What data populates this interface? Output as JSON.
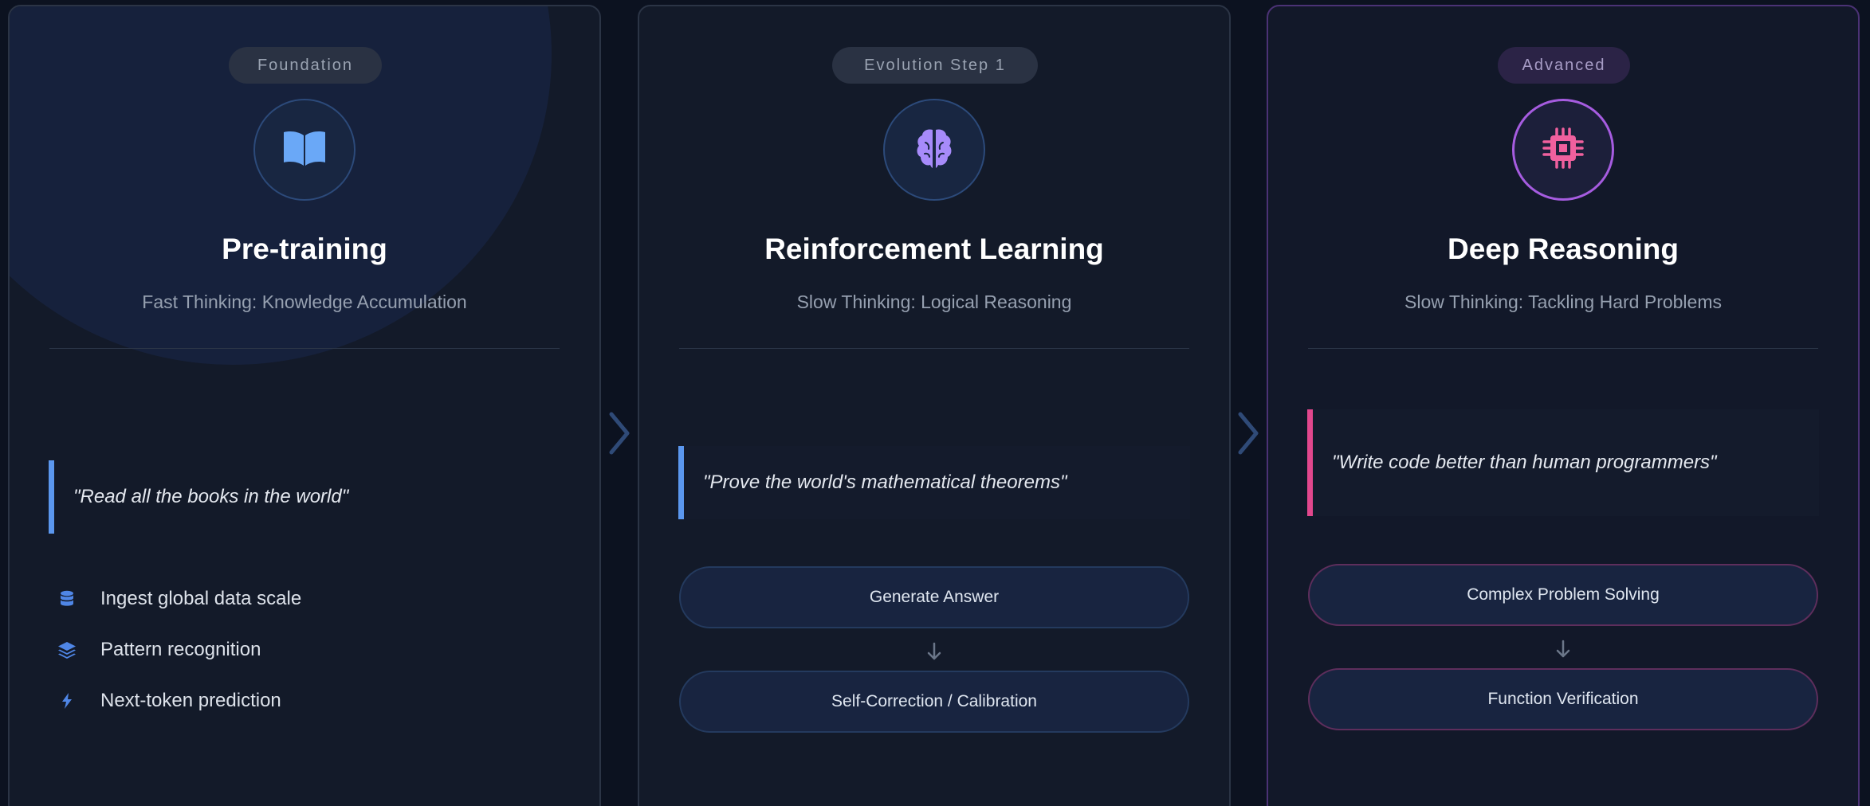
{
  "colors": {
    "background": "#0c1220",
    "card": "#131a29",
    "accent_blue": "#5b97ee",
    "accent_purple": "#a65ce0",
    "accent_pink": "#e2478d"
  },
  "stages": [
    {
      "badge": "Foundation",
      "icon": "open-book-icon",
      "title": "Pre-training",
      "subtitle": "Fast Thinking: Knowledge Accumulation",
      "quote": "\"Read all the books in the world\"",
      "features": [
        {
          "icon": "database-icon",
          "label": "Ingest global data scale"
        },
        {
          "icon": "layers-icon",
          "label": "Pattern recognition"
        },
        {
          "icon": "bolt-icon",
          "label": "Next-token prediction"
        }
      ]
    },
    {
      "badge": "Evolution Step 1",
      "icon": "brain-icon",
      "title": "Reinforcement Learning",
      "subtitle": "Slow Thinking: Logical Reasoning",
      "quote": "\"Prove the world's mathematical theorems\"",
      "steps": [
        "Generate Answer",
        "Self-Correction / Calibration"
      ]
    },
    {
      "badge": "Advanced",
      "icon": "chip-icon",
      "title": "Deep Reasoning",
      "subtitle": "Slow Thinking: Tackling Hard Problems",
      "quote": "\"Write code better than human programmers\"",
      "steps": [
        "Complex Problem Solving",
        "Function Verification"
      ]
    }
  ]
}
